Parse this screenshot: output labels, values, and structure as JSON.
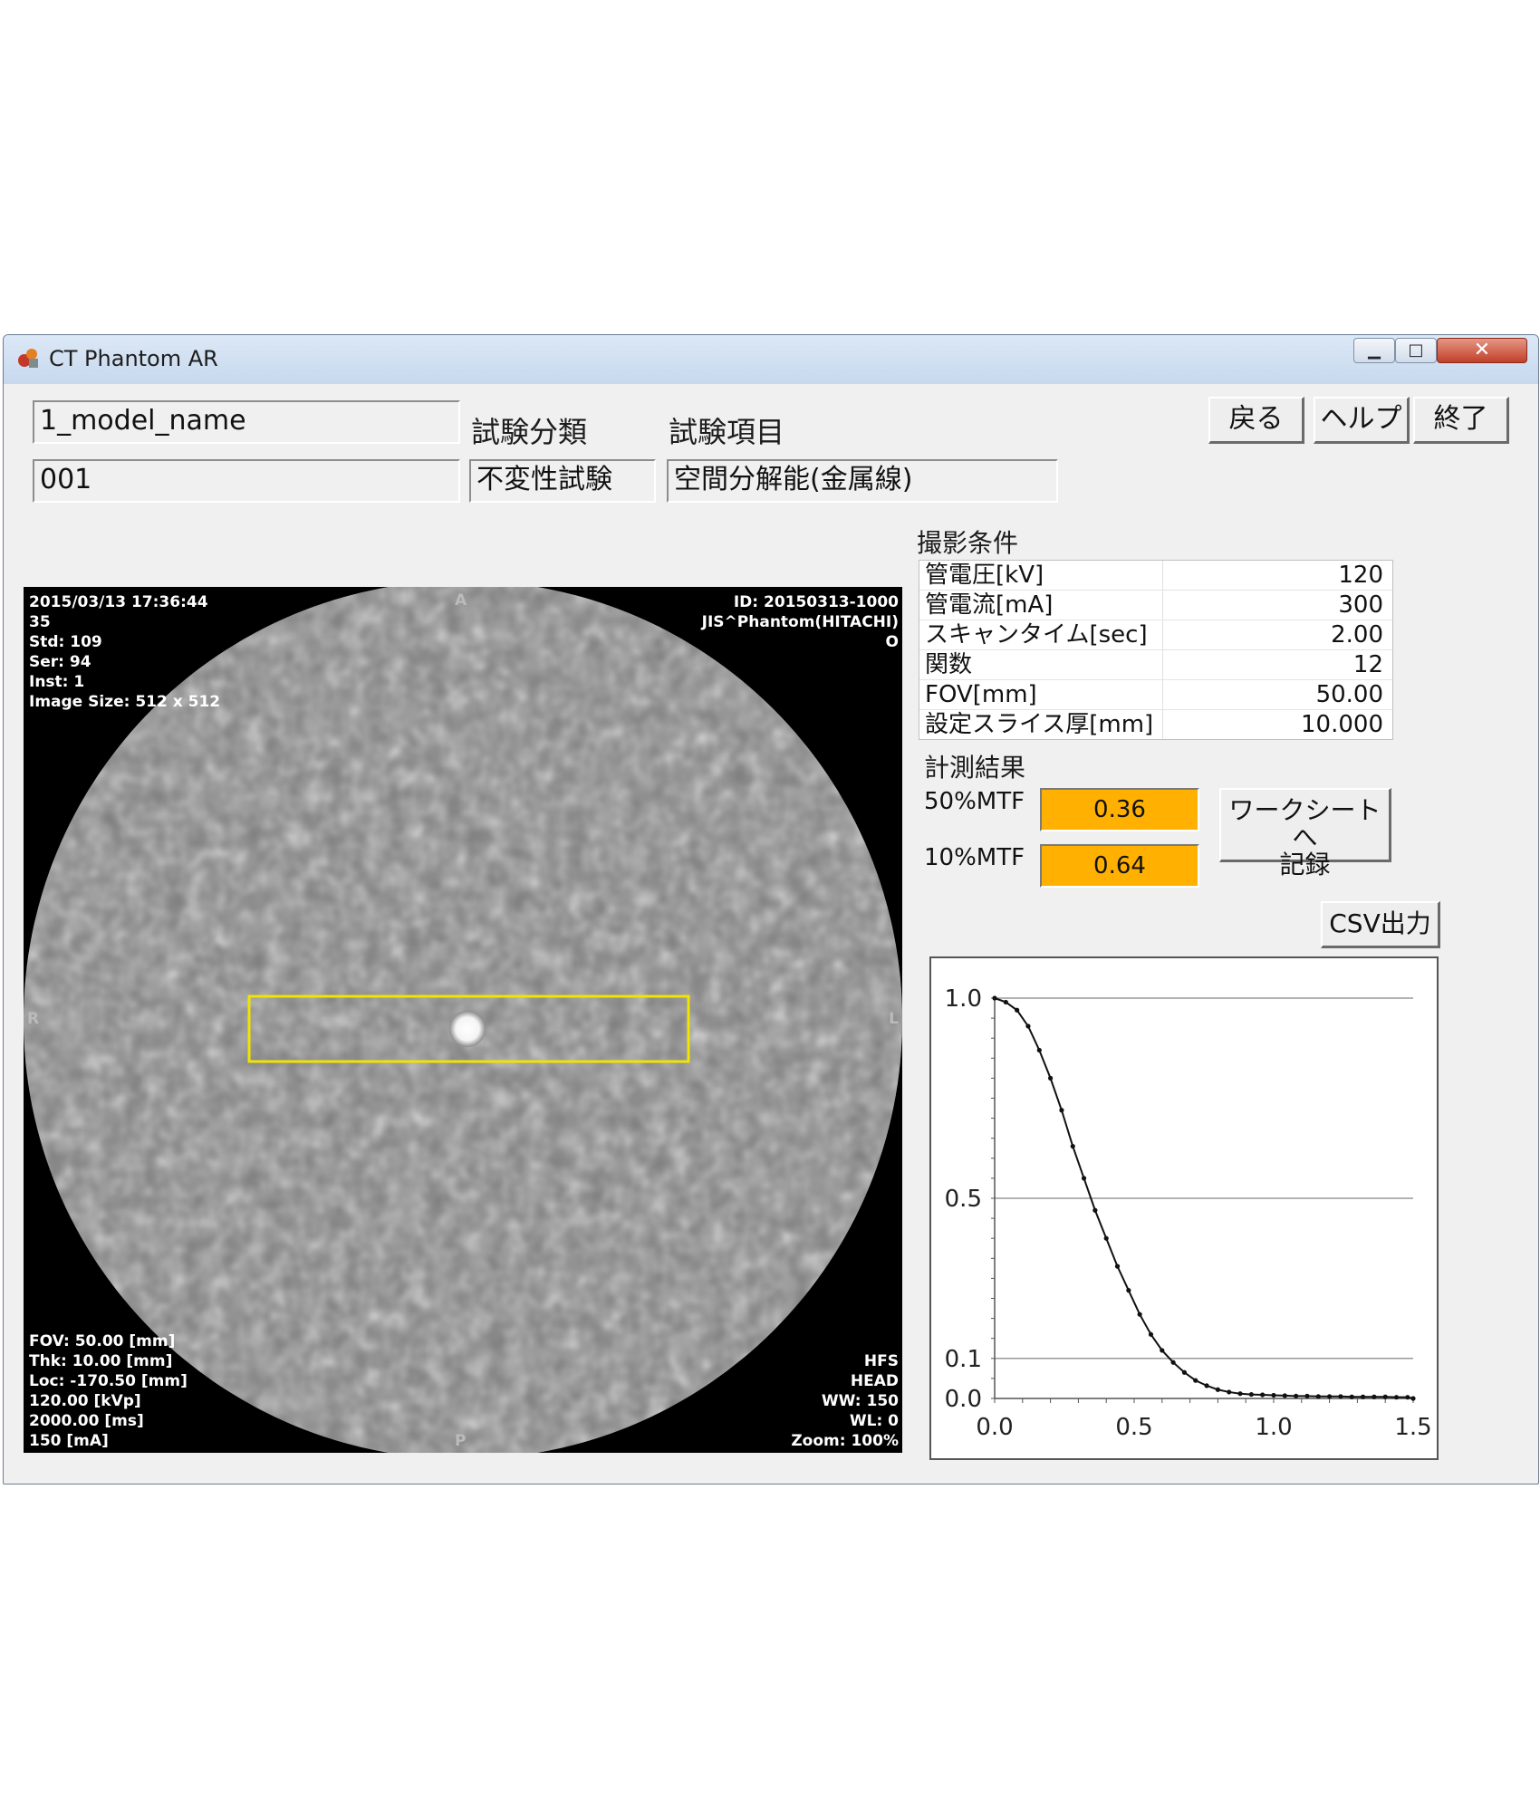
{
  "window": {
    "title": "CT Phantom AR"
  },
  "header": {
    "model_name": "1_model_name",
    "model_id": "001",
    "category_label": "試験分類",
    "category_value": "不変性試験",
    "item_label": "試験項目",
    "item_value": "空間分解能(金属線)",
    "back_button": "戻る",
    "help_button": "ヘルプ",
    "exit_button": "終了"
  },
  "ct_image": {
    "top_left": [
      "2015/03/13 17:36:44",
      "35",
      "Std: 109",
      "Ser: 94",
      "Inst: 1",
      "Image Size: 512 x 512"
    ],
    "top_right": [
      "ID: 20150313-1000",
      "JIS^Phantom(HITACHI)",
      "O"
    ],
    "bottom_left": [
      "FOV: 50.00 [mm]",
      "Thk: 10.00 [mm]",
      "Loc: -170.50 [mm]",
      "120.00 [kVp]",
      "2000.00 [ms]",
      "150 [mA]"
    ],
    "bottom_right": [
      "HFS",
      "HEAD",
      "WW: 150",
      "WL: 0",
      "Zoom: 100%"
    ],
    "orient_top": "A",
    "orient_bottom": "P",
    "orient_left": "R",
    "orient_right": "L"
  },
  "conditions": {
    "title": "撮影条件",
    "rows": [
      {
        "label": "管電圧[kV]",
        "value": "120"
      },
      {
        "label": "管電流[mA]",
        "value": "300"
      },
      {
        "label": "スキャンタイム[sec]",
        "value": "2.00"
      },
      {
        "label": "関数",
        "value": "12"
      },
      {
        "label": "FOV[mm]",
        "value": "50.00"
      },
      {
        "label": "設定スライス厚[mm]",
        "value": "10.000"
      }
    ]
  },
  "results": {
    "title": "計測結果",
    "mtf50_label": "50%MTF",
    "mtf50_value": "0.36",
    "mtf10_label": "10%MTF",
    "mtf10_value": "0.64",
    "record_button_line1": "ワークシートへ",
    "record_button_line2": "記録",
    "csv_button": "CSV出力"
  },
  "chart_data": {
    "type": "line",
    "title": "",
    "xlabel": "",
    "ylabel": "",
    "xlim": [
      0,
      1.5
    ],
    "ylim": [
      0,
      1.0
    ],
    "x_ticks": [
      "0.0",
      "0.5",
      "1.0",
      "1.5"
    ],
    "y_ticks": [
      "0.0",
      "0.1",
      "0.5",
      "1.0"
    ],
    "y_tick_values": [
      0.0,
      0.1,
      0.5,
      1.0
    ],
    "grid_y": [
      0.1,
      0.5,
      1.0
    ],
    "series": [
      {
        "x": [
          0.0,
          0.04,
          0.08,
          0.12,
          0.16,
          0.2,
          0.24,
          0.28,
          0.32,
          0.36,
          0.4,
          0.44,
          0.48,
          0.52,
          0.56,
          0.6,
          0.64,
          0.68,
          0.72,
          0.76,
          0.8,
          0.84,
          0.88,
          0.92,
          0.96,
          1.0,
          1.04,
          1.08,
          1.12,
          1.16,
          1.2,
          1.24,
          1.28,
          1.32,
          1.36,
          1.4,
          1.44,
          1.48,
          1.5
        ],
        "y": [
          1.0,
          0.99,
          0.97,
          0.93,
          0.87,
          0.8,
          0.72,
          0.63,
          0.55,
          0.47,
          0.4,
          0.33,
          0.27,
          0.21,
          0.16,
          0.12,
          0.09,
          0.065,
          0.045,
          0.032,
          0.022,
          0.016,
          0.012,
          0.01,
          0.009,
          0.008,
          0.007,
          0.006,
          0.006,
          0.005,
          0.005,
          0.005,
          0.004,
          0.004,
          0.004,
          0.004,
          0.003,
          0.003,
          0.0
        ]
      }
    ]
  }
}
